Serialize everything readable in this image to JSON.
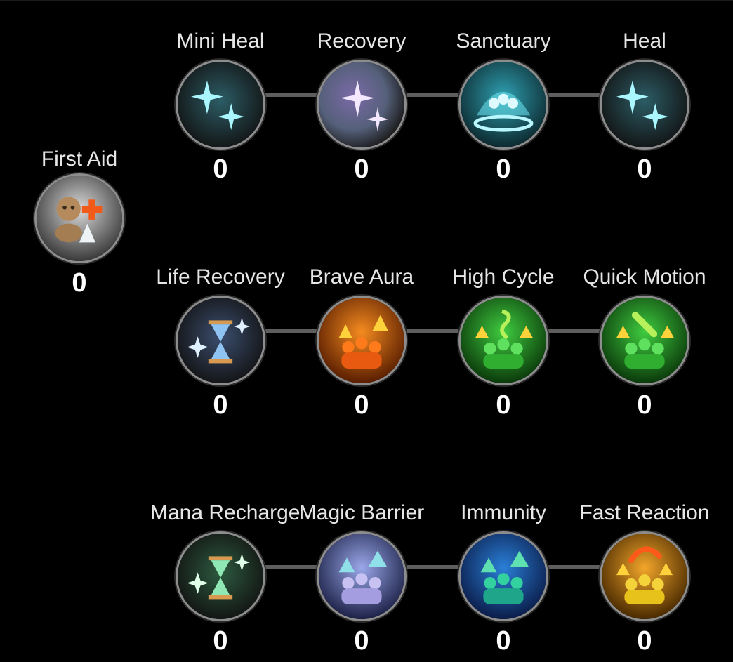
{
  "standalone": {
    "name": "First Aid",
    "level": "0",
    "icon": "first-aid-icon"
  },
  "rows": [
    {
      "skills": [
        {
          "name": "Mini Heal",
          "level": "0",
          "icon": "sparkle-icon",
          "color": "#5fd9e6"
        },
        {
          "name": "Recovery",
          "level": "0",
          "icon": "sparkle-purple-icon",
          "color": "#b88de0"
        },
        {
          "name": "Sanctuary",
          "level": "0",
          "icon": "sanctuary-dome-icon",
          "color": "#3cc6d6"
        },
        {
          "name": "Heal",
          "level": "0",
          "icon": "sparkle-icon",
          "color": "#5fd9e6"
        }
      ]
    },
    {
      "skills": [
        {
          "name": "Life Recovery",
          "level": "0",
          "icon": "hourglass-icon",
          "color": "#7fb0e8"
        },
        {
          "name": "Brave Aura",
          "level": "0",
          "icon": "party-buff-orange-icon",
          "color": "#f07a1a"
        },
        {
          "name": "High Cycle",
          "level": "0",
          "icon": "party-buff-green-icon",
          "color": "#37c233"
        },
        {
          "name": "Quick Motion",
          "level": "0",
          "icon": "party-buff-green-icon",
          "color": "#37c233"
        }
      ]
    },
    {
      "skills": [
        {
          "name": "Mana Recharge",
          "level": "0",
          "icon": "hourglass-green-icon",
          "color": "#59d889"
        },
        {
          "name": "Magic Barrier",
          "level": "0",
          "icon": "party-buff-violet-icon",
          "color": "#8e9ce0"
        },
        {
          "name": "Immunity",
          "level": "0",
          "icon": "party-buff-blue-icon",
          "color": "#2f8ed8"
        },
        {
          "name": "Fast Reaction",
          "level": "0",
          "icon": "party-buff-yellow-icon",
          "color": "#f0b21a"
        }
      ]
    }
  ]
}
